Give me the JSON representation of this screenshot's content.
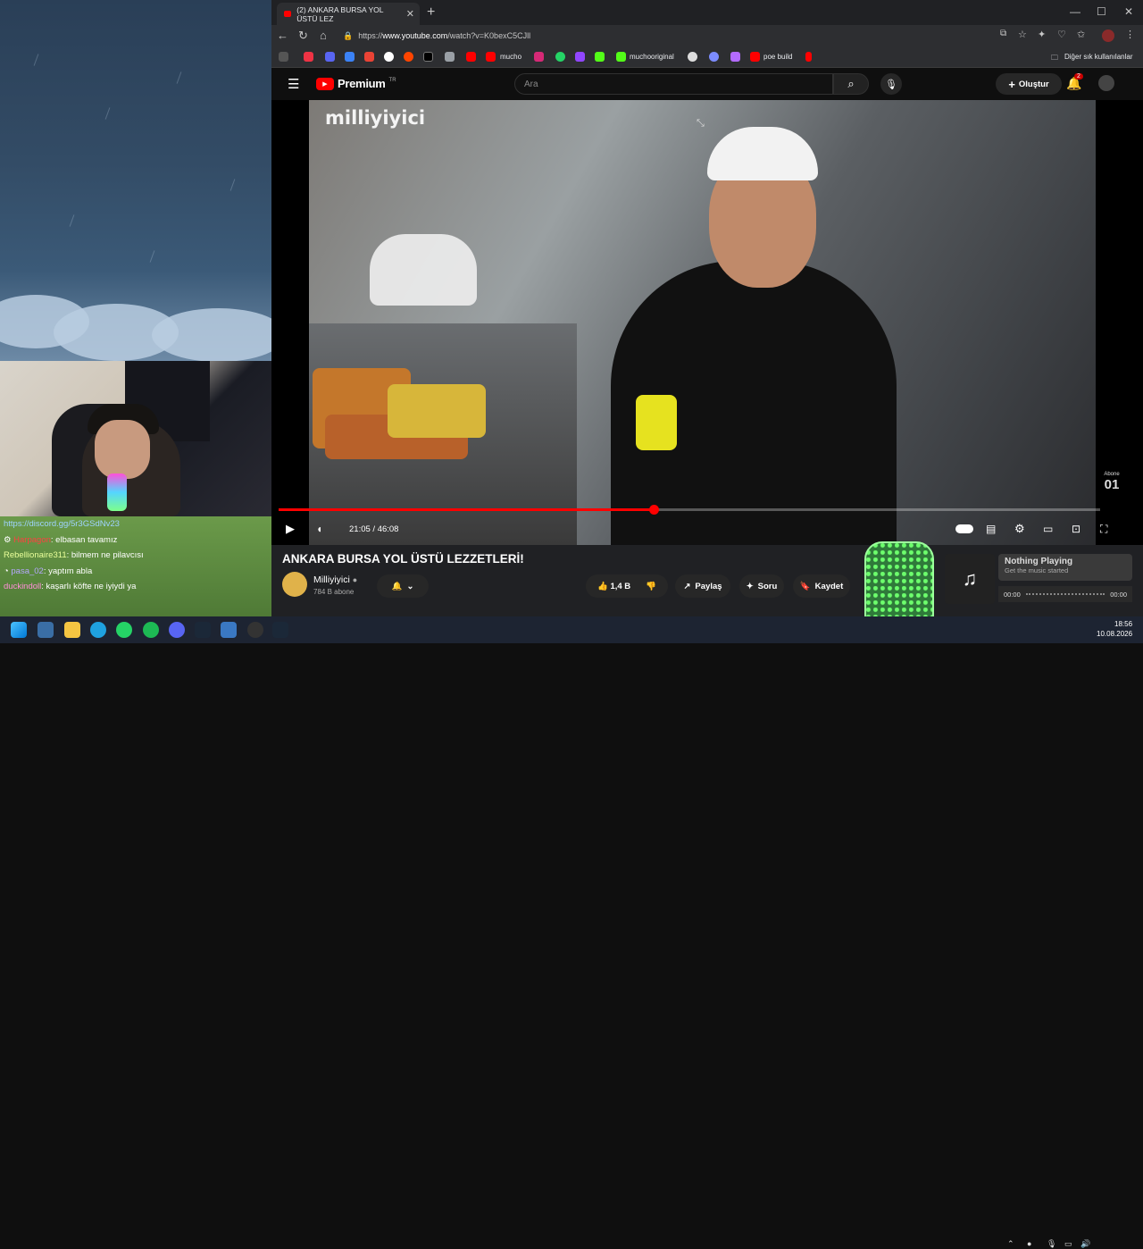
{
  "browser": {
    "tab_title": "(2) ANKARA BURSA YOL ÜSTÜ LEZ",
    "url_prefix": "https://",
    "url_domain": "www.youtube.com",
    "url_path": "/watch?v=K0bexC5CJll",
    "bookmarks": [
      "mucho",
      "muchooriginal",
      "poe build"
    ],
    "other_bookmarks": "Diğer sık kullanılanlar"
  },
  "youtube": {
    "logo": "Premium",
    "logo_region": "TR",
    "search_placeholder": "Ara",
    "create_label": "Oluştur",
    "notif_count": "2",
    "watermark": "milliyiyici",
    "time": "21:05 / 46:08",
    "progress_fraction": 0.456,
    "video_title": "ANKARA BURSA YOL ÜSTÜ LEZZETLERİ!",
    "channel_name": "Milliyiyici",
    "subscribers": "784 B abone",
    "likes": "1,4 B",
    "share": "Paylaş",
    "ask": "Soru",
    "save": "Kaydet",
    "corner_badge": "01",
    "corner_badge_top": "Abone"
  },
  "chat": [
    {
      "user": "",
      "msg": "https://discord.gg/5r3GSdNv23"
    },
    {
      "user": "Harpagon",
      "msg": ": elbasan tavamız"
    },
    {
      "user": "Rebellionaire311",
      "msg": ": bilmem ne pilavcısı"
    },
    {
      "user": "pasa_02",
      "msg": ": yaptım abla"
    },
    {
      "user": "duckindoll",
      "msg": ": kaşarlı köfte ne iyiydi ya"
    }
  ],
  "player_widget": {
    "title": "Nothing Playing",
    "subtitle": "Get the music started",
    "time_start": "00:00",
    "time_end": "00:00"
  },
  "taskbar": {
    "time": "18:56",
    "date": "10.08.2026"
  },
  "colors": {
    "accent": "#ff0000",
    "chat_bg": "#5b8a3f"
  }
}
